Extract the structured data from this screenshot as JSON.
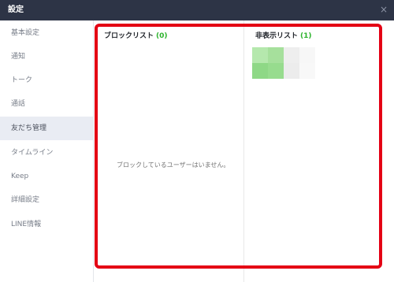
{
  "window": {
    "title": "設定",
    "close_symbol": "×"
  },
  "sidebar": {
    "items": [
      {
        "label": "基本設定",
        "active": false
      },
      {
        "label": "通知",
        "active": false
      },
      {
        "label": "トーク",
        "active": false
      },
      {
        "label": "通話",
        "active": false
      },
      {
        "label": "友だち管理",
        "active": true
      },
      {
        "label": "タイムライン",
        "active": false
      },
      {
        "label": "Keep",
        "active": false
      },
      {
        "label": "詳細設定",
        "active": false
      },
      {
        "label": "LINE情報",
        "active": false
      }
    ]
  },
  "block_list": {
    "title": "ブロックリスト",
    "count": "(0)",
    "empty_message": "ブロックしているユーザーはいません。"
  },
  "hidden_list": {
    "title": "非表示リスト",
    "count": "(1)"
  },
  "colors": {
    "titlebar": "#2d3446",
    "count_green": "#2cb32c",
    "highlight_red": "#e40014",
    "active_nav_bg": "#e9ecf3"
  }
}
